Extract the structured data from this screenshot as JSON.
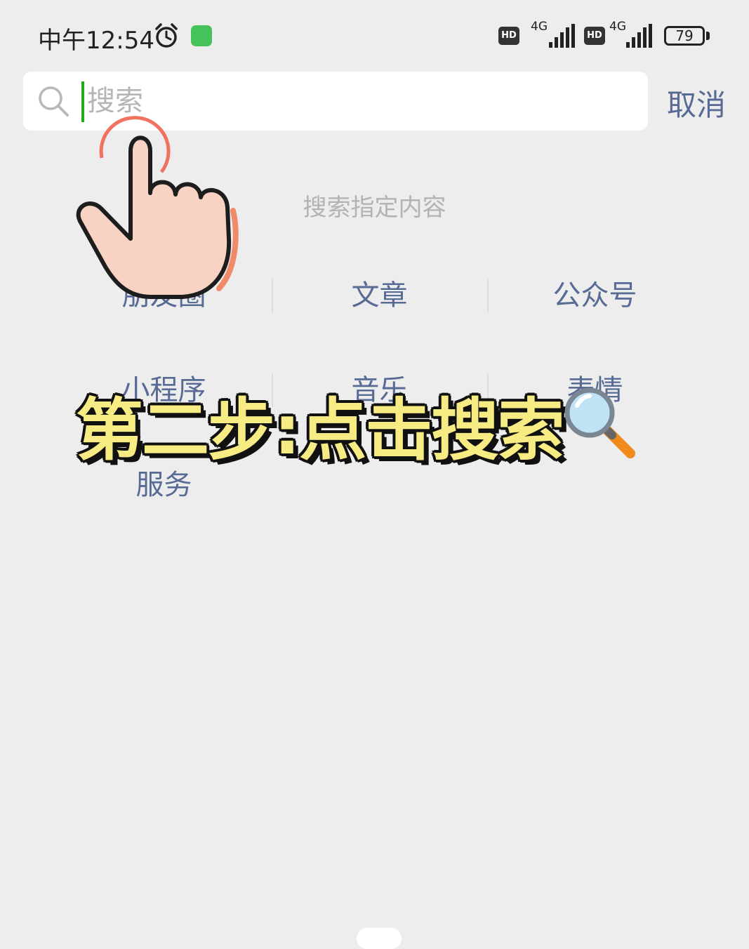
{
  "status_bar": {
    "time": "中午12:54",
    "hd_label": "HD",
    "network": "4G",
    "battery": "79"
  },
  "search": {
    "placeholder": "搜索",
    "value": "",
    "cancel_label": "取消"
  },
  "hint": "搜索指定内容",
  "categories": [
    {
      "label": "朋友圈"
    },
    {
      "label": "文章"
    },
    {
      "label": "公众号"
    },
    {
      "label": "小程序"
    },
    {
      "label": "音乐"
    },
    {
      "label": "表情"
    },
    {
      "label": "服务"
    }
  ],
  "overlay": {
    "caption": "第二步:点击搜索"
  },
  "colors": {
    "link": "#576b95",
    "caret": "#1aad19",
    "caption": "#f7ec83",
    "background": "#ededed"
  },
  "icons": [
    "alarm-icon",
    "app-notification-icon",
    "signal-icon",
    "battery-icon",
    "search-icon",
    "hand-pointer-icon",
    "magnifier-icon"
  ]
}
